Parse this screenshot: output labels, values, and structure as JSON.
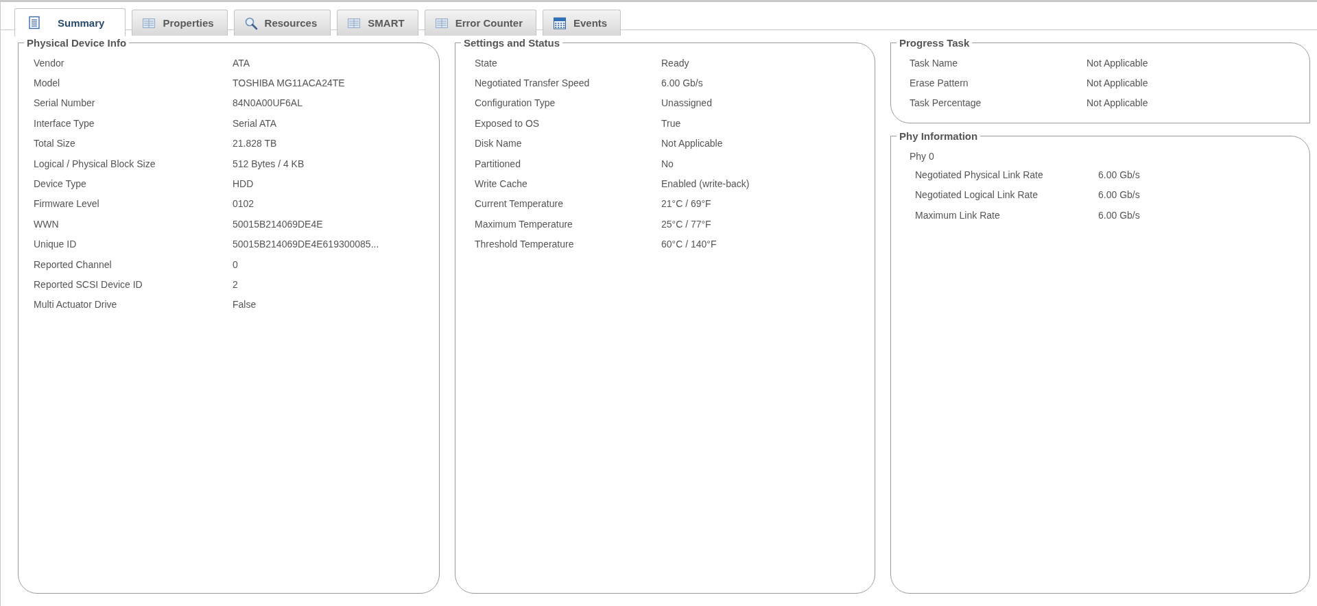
{
  "tabs": [
    {
      "label": "Summary",
      "kind": "document",
      "selected": true
    },
    {
      "label": "Properties",
      "kind": "grid",
      "selected": false
    },
    {
      "label": "Resources",
      "kind": "search",
      "selected": false
    },
    {
      "label": "SMART",
      "kind": "grid",
      "selected": false
    },
    {
      "label": "Error Counter",
      "kind": "grid",
      "selected": false
    },
    {
      "label": "Events",
      "kind": "calendar",
      "selected": false
    }
  ],
  "physical_device_info": {
    "title": "Physical Device Info",
    "rows": [
      {
        "label": "Vendor",
        "value": "ATA"
      },
      {
        "label": "Model",
        "value": "TOSHIBA MG11ACA24TE"
      },
      {
        "label": "Serial Number",
        "value": "84N0A00UF6AL"
      },
      {
        "label": "Interface Type",
        "value": "Serial ATA"
      },
      {
        "label": "Total Size",
        "value": "21.828 TB"
      },
      {
        "label": "Logical / Physical Block Size",
        "value": "512 Bytes / 4 KB"
      },
      {
        "label": "Device Type",
        "value": "HDD"
      },
      {
        "label": "Firmware Level",
        "value": "0102"
      },
      {
        "label": "WWN",
        "value": "50015B214069DE4E"
      },
      {
        "label": "Unique ID",
        "value": "50015B214069DE4E619300085..."
      },
      {
        "label": "Reported Channel",
        "value": "0"
      },
      {
        "label": "Reported SCSI Device ID",
        "value": "2"
      },
      {
        "label": "Multi Actuator Drive",
        "value": "False"
      }
    ]
  },
  "settings_and_status": {
    "title": "Settings and Status",
    "rows": [
      {
        "label": "State",
        "value": "Ready"
      },
      {
        "label": "Negotiated Transfer Speed",
        "value": "6.00 Gb/s"
      },
      {
        "label": "Configuration Type",
        "value": "Unassigned"
      },
      {
        "label": "Exposed to OS",
        "value": "True"
      },
      {
        "label": "Disk Name",
        "value": "Not Applicable"
      },
      {
        "label": "Partitioned",
        "value": "No"
      },
      {
        "label": "Write Cache",
        "value": "Enabled (write-back)"
      },
      {
        "label": "Current Temperature",
        "value": "21°C / 69°F"
      },
      {
        "label": "Maximum Temperature",
        "value": "25°C / 77°F"
      },
      {
        "label": "Threshold Temperature",
        "value": "60°C / 140°F"
      }
    ]
  },
  "progress_task": {
    "title": "Progress Task",
    "rows": [
      {
        "label": "Task Name",
        "value": "Not Applicable"
      },
      {
        "label": "Erase Pattern",
        "value": "Not Applicable"
      },
      {
        "label": "Task Percentage",
        "value": "Not Applicable"
      }
    ]
  },
  "phy_information": {
    "title": "Phy Information",
    "phys": [
      {
        "name": "Phy 0",
        "rows": [
          {
            "label": "Negotiated Physical Link Rate",
            "value": "6.00 Gb/s"
          },
          {
            "label": "Negotiated Logical Link Rate",
            "value": "6.00 Gb/s"
          },
          {
            "label": "Maximum Link Rate",
            "value": "6.00 Gb/s"
          }
        ]
      }
    ]
  }
}
